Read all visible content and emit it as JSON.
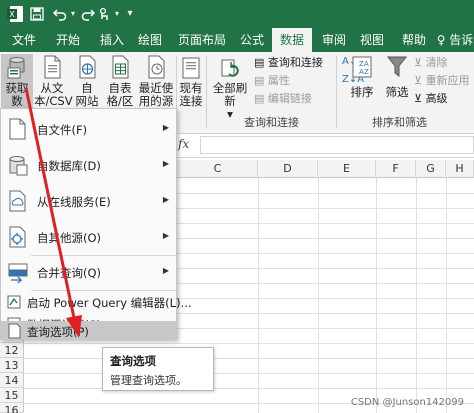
{
  "quick_access": {
    "save_icon": "save-icon",
    "undo_icon": "undo-icon",
    "redo_icon": "redo-icon",
    "touch_icon": "touch-mode-icon",
    "more_icon": "customize-toolbar-icon"
  },
  "tabs": [
    {
      "label": "文件"
    },
    {
      "label": "开始"
    },
    {
      "label": "插入"
    },
    {
      "label": "绘图"
    },
    {
      "label": "页面布局"
    },
    {
      "label": "公式"
    },
    {
      "label": "数据",
      "active": true
    },
    {
      "label": "审阅"
    },
    {
      "label": "视图"
    },
    {
      "label": "帮助"
    },
    {
      "label": "♀ 告诉"
    }
  ],
  "ribbon": {
    "get_data": {
      "line1": "获取数",
      "line2": "据 ▾"
    },
    "from_text": {
      "line1": "从文",
      "line2": "本/CSV"
    },
    "from_web": {
      "line1": "自",
      "line2": "网站"
    },
    "from_table": {
      "line1": "自表",
      "line2": "格/区域"
    },
    "recent_sources": {
      "line1": "最近使",
      "line2": "用的源"
    },
    "existing": {
      "line1": "现有",
      "line2": "连接"
    },
    "refresh_all": {
      "line1": "全部刷新",
      "line2": "▾"
    },
    "queries_connections": "查询和连接",
    "properties": "属性",
    "edit_links": "编辑链接",
    "group_queries": "查询和连接",
    "sort": "排序",
    "filter": "筛选",
    "clear": "清除",
    "reapply": "重新应用",
    "advanced": "高级",
    "group_sort": "排序和筛选"
  },
  "formula_bar": {
    "fx": "fx",
    "value": ""
  },
  "columns": [
    "C",
    "D",
    "E",
    "F",
    "G",
    "H"
  ],
  "rows": [
    "12",
    "13",
    "14",
    "15",
    "16"
  ],
  "menu": {
    "items": [
      {
        "label": "自文件(F)",
        "submenu": true,
        "icon": "file-icon"
      },
      {
        "label": "自数据库(D)",
        "submenu": true,
        "icon": "database-icon"
      },
      {
        "label": "从在线服务(E)",
        "submenu": true,
        "icon": "cloud-service-icon"
      },
      {
        "label": "自其他源(O)",
        "submenu": true,
        "icon": "other-source-icon"
      },
      {
        "label": "合并查询(Q)",
        "submenu": true,
        "icon": "combine-query-icon"
      },
      {
        "label": "启动 Power Query 编辑器(L)...",
        "submenu": false,
        "icon": "power-query-icon"
      },
      {
        "label": "数据源设置(S)...",
        "submenu": false,
        "icon": "data-source-settings-icon"
      },
      {
        "label": "查询选项(P)",
        "submenu": false,
        "icon": "query-options-icon",
        "highlighted": true
      }
    ]
  },
  "tooltip": {
    "title": "查询选项",
    "description": "管理查询选项。"
  },
  "watermark": "CSDN @Junson142099",
  "colors": {
    "brand": "#217346",
    "annotation_arrow": "#e02020",
    "ribbon_bg": "#f3f3f3"
  }
}
